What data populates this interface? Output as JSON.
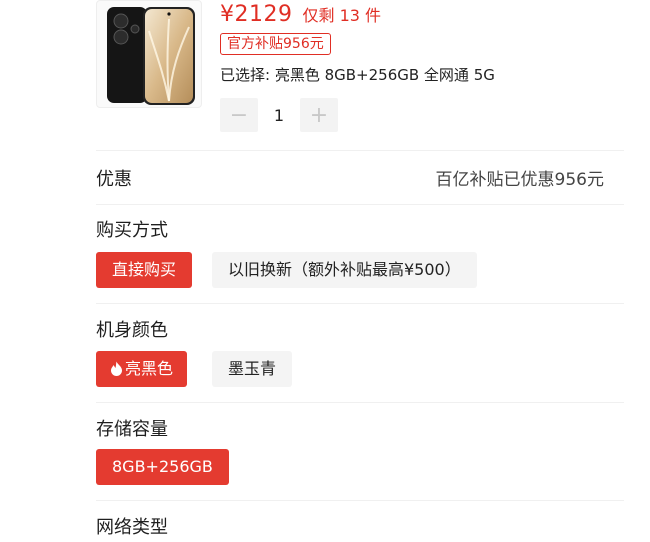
{
  "product": {
    "price": "¥2129",
    "stock_text": "仅剩 13 件",
    "subsidy_tag": "官方补贴956元",
    "selected_text": "已选择: 亮黑色 8GB+256GB 全网通 5G",
    "quantity": "1",
    "minus_label": "−",
    "plus_label": "+"
  },
  "promo": {
    "label": "优惠",
    "value": "百亿补贴已优惠956元"
  },
  "purchase_method": {
    "label": "购买方式",
    "options": [
      {
        "label": "直接购买",
        "selected": true
      },
      {
        "label": "以旧换新（额外补贴最高¥500）",
        "selected": false
      }
    ]
  },
  "color": {
    "label": "机身颜色",
    "options": [
      {
        "label": "亮黑色",
        "selected": true,
        "icon": "flame-icon"
      },
      {
        "label": "墨玉青",
        "selected": false
      }
    ]
  },
  "storage": {
    "label": "存储容量",
    "options": [
      {
        "label": "8GB+256GB",
        "selected": true
      }
    ]
  },
  "network": {
    "label": "网络类型"
  },
  "colors": {
    "accent": "#e02e24",
    "selected_bg": "#e43b30",
    "option_bg": "#f4f4f4"
  }
}
